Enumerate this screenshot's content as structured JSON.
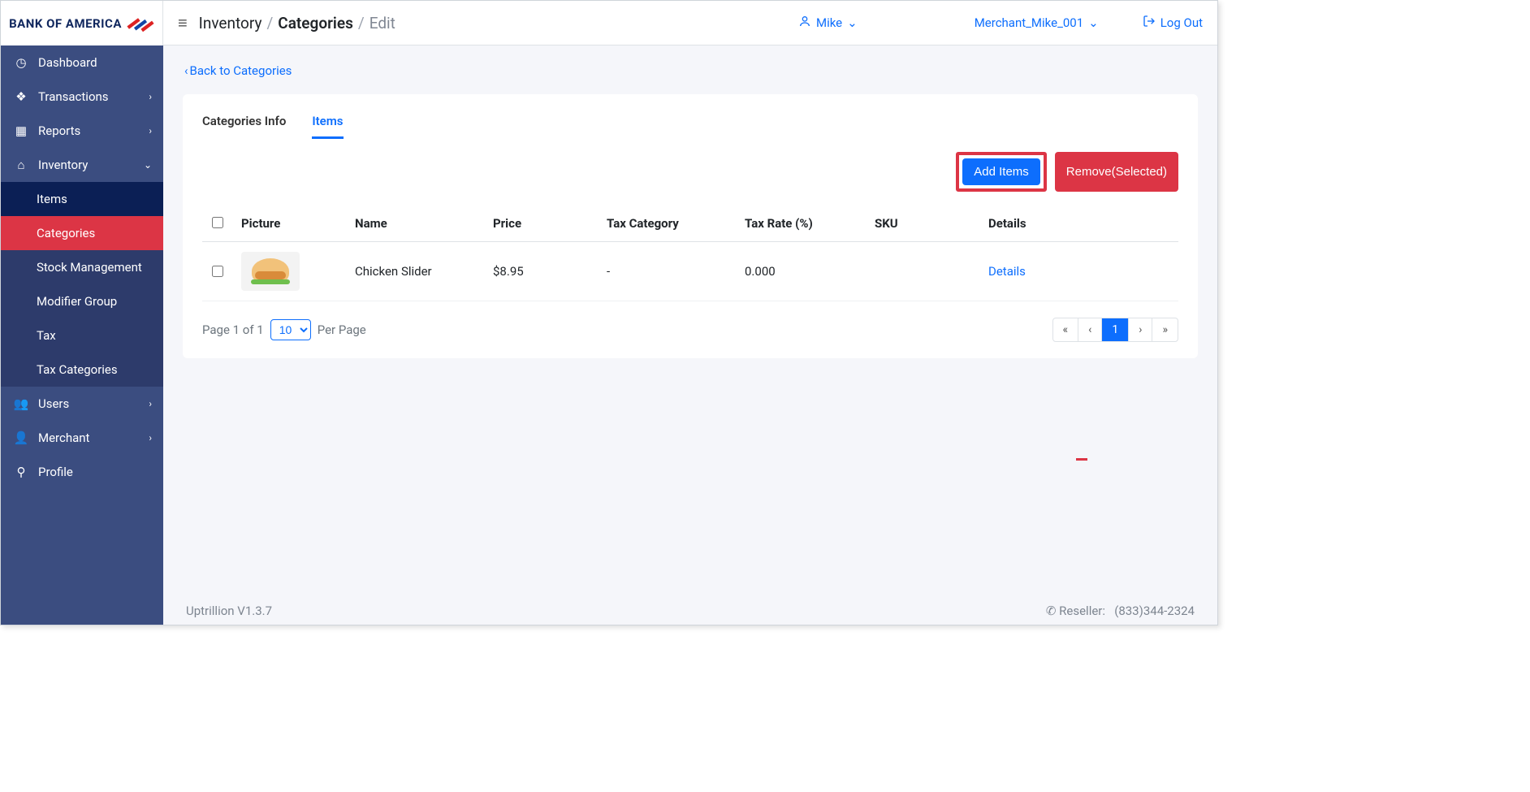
{
  "brand": "BANK OF AMERICA",
  "breadcrumb": {
    "root": "Inventory",
    "mid": "Categories",
    "leaf": "Edit"
  },
  "topbar": {
    "user": "Mike",
    "merchant": "Merchant_Mike_001",
    "logout": "Log Out"
  },
  "back_link": "Back to Categories",
  "sidebar": {
    "items": [
      {
        "label": "Dashboard",
        "icon": "gauge"
      },
      {
        "label": "Transactions",
        "icon": "coins",
        "chev": true
      },
      {
        "label": "Reports",
        "icon": "table",
        "chev": true
      },
      {
        "label": "Inventory",
        "icon": "home",
        "chev_down": true
      },
      {
        "label": "Items",
        "sub": true,
        "highlight": true
      },
      {
        "label": "Categories",
        "sub": true,
        "active": true
      },
      {
        "label": "Stock Management",
        "sub": true
      },
      {
        "label": "Modifier Group",
        "sub": true
      },
      {
        "label": "Tax",
        "sub": true
      },
      {
        "label": "Tax Categories",
        "sub": true
      },
      {
        "label": "Users",
        "icon": "users",
        "chev": true
      },
      {
        "label": "Merchant",
        "icon": "merchant",
        "chev": true
      },
      {
        "label": "Profile",
        "icon": "profile"
      }
    ]
  },
  "tabs": {
    "info": "Categories Info",
    "items": "Items"
  },
  "actions": {
    "add": "Add Items",
    "remove": "Remove(Selected)"
  },
  "table": {
    "headers": {
      "picture": "Picture",
      "name": "Name",
      "price": "Price",
      "tax_category": "Tax Category",
      "tax_rate": "Tax Rate (%)",
      "sku": "SKU",
      "details": "Details"
    },
    "rows": [
      {
        "name": "Chicken Slider",
        "price": "$8.95",
        "tax_category": "-",
        "tax_rate": "0.000",
        "sku": "",
        "details": "Details"
      }
    ]
  },
  "pager": {
    "page_text": "Page 1 of 1",
    "per_page_label": "Per Page",
    "page_size": "10",
    "current": "1"
  },
  "footer": {
    "version": "Uptrillion V1.3.7",
    "reseller_label": "Reseller:",
    "reseller_phone": "(833)344-2324"
  }
}
